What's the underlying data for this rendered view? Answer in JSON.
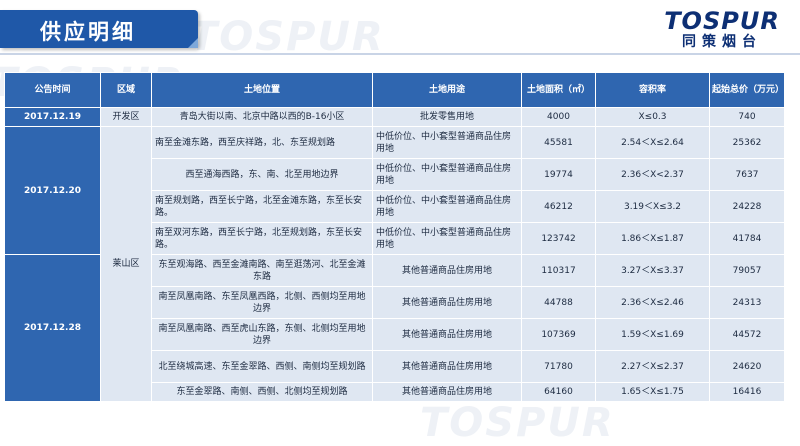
{
  "header": {
    "title": "供应明细",
    "logo_text": "TOSPUR",
    "logo_subtitle": "同策烟台",
    "watermark": "TOSPUR"
  },
  "table": {
    "columns": [
      "公告时间",
      "区域",
      "土地位置",
      "土地用途",
      "土地面积（㎡）",
      "容积率",
      "起始总价（万元）"
    ],
    "dates": [
      "2017.12.19",
      "2017.12.20",
      "2017.12.28"
    ],
    "regions": [
      "开发区",
      "莱山区"
    ],
    "rows": [
      {
        "location": "青岛大街以南、北京中路以西的B-16小区",
        "usage": "批发零售用地",
        "area": "4000",
        "far": "X≤0.3",
        "price": "740"
      },
      {
        "location": "南至金滩东路，西至庆祥路，北、东至规划路",
        "usage": "中低价位、中小套型普通商品住房用地",
        "area": "45581",
        "far": "2.54＜X≤2.64",
        "price": "25362"
      },
      {
        "location": "西至通海西路，东、南、北至用地边界",
        "usage": "中低价位、中小套型普通商品住房用地",
        "area": "19774",
        "far": "2.36＜X<2.37",
        "price": "7637"
      },
      {
        "location": "南至规划路，西至长宁路，北至金滩东路，东至长安路。",
        "usage": "中低价位、中小套型普通商品住房用地",
        "area": "46212",
        "far": "3.19＜X≤3.2",
        "price": "24228"
      },
      {
        "location": "南至双河东路，西至长宁路，北至规划路，东至长安路。",
        "usage": "中低价位、中小套型普通商品住房用地",
        "area": "123742",
        "far": "1.86＜X≤1.87",
        "price": "41784"
      },
      {
        "location": "东至观海路、西至金滩南路、南至逛荡河、北至金滩东路",
        "usage": "其他普通商品住房用地",
        "area": "110317",
        "far": "3.27＜X≤3.37",
        "price": "79057"
      },
      {
        "location": "南至凤凰南路、东至凤凰西路，北侧、西侧均至用地边界",
        "usage": "其他普通商品住房用地",
        "area": "44788",
        "far": "2.36＜X≤2.46",
        "price": "24313"
      },
      {
        "location": "南至凤凰南路、西至虎山东路，东侧、北侧均至用地边界",
        "usage": "其他普通商品住房用地",
        "area": "107369",
        "far": "1.59＜X≤1.69",
        "price": "44572"
      },
      {
        "location": "北至绕城高速、东至金翠路、西侧、南侧均至规划路",
        "usage": "其他普通商品住房用地",
        "area": "71780",
        "far": "2.27＜X≤2.37",
        "price": "24620"
      },
      {
        "location": "东至金翠路、南侧、西侧、北侧均至规划路",
        "usage": "其他普通商品住房用地",
        "area": "64160",
        "far": "1.65＜X≤1.75",
        "price": "16416"
      }
    ]
  },
  "colors": {
    "header_blue": "#2f66b0",
    "title_blue": "#1f58a8",
    "cell_bg": "#dfe7f2",
    "logo_navy": "#0d2f74"
  }
}
